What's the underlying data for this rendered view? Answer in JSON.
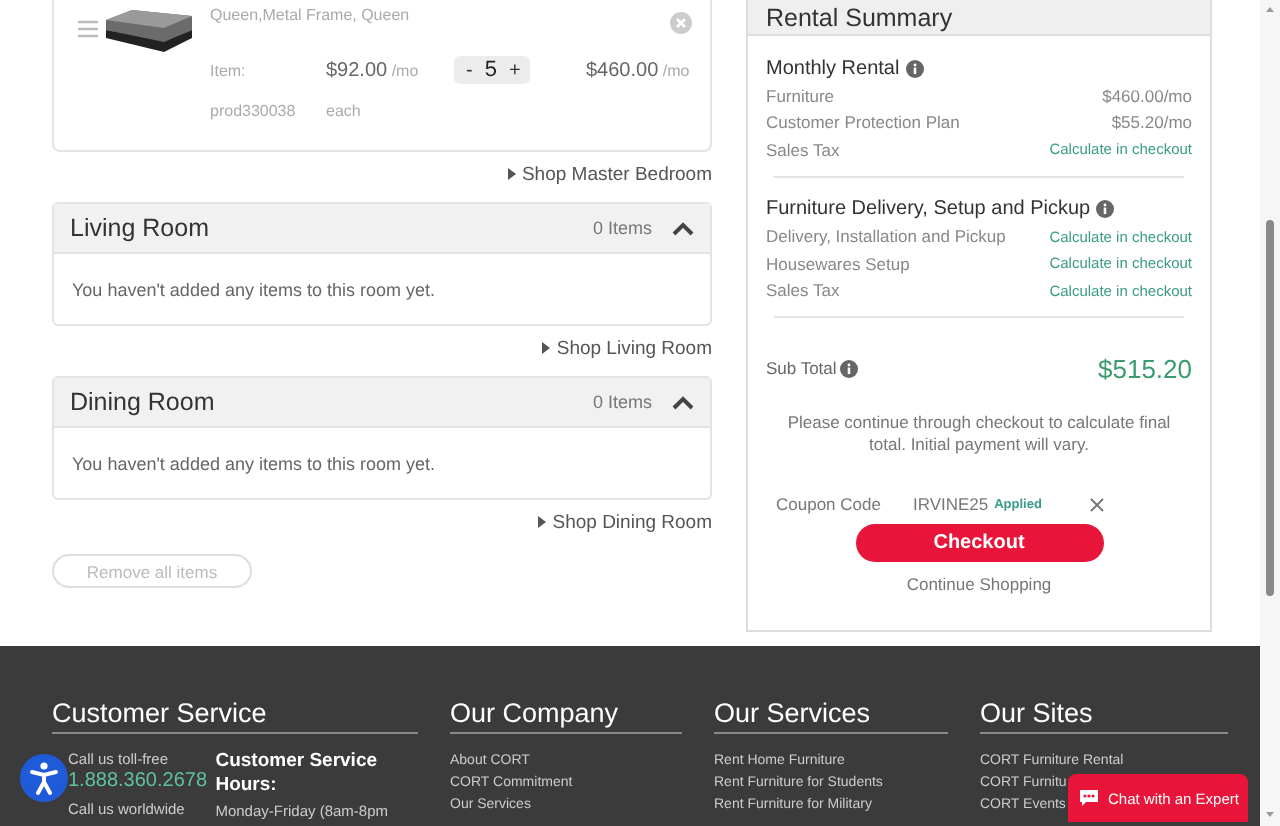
{
  "cart_item": {
    "name": "Queen,Metal Frame, Queen",
    "item_label": "Item:",
    "sku": "prod330038",
    "unit_price": "$92.00",
    "unit_suffix": "/mo",
    "unit_note": "each",
    "quantity": "5",
    "minus": "-",
    "plus": "+",
    "total": "$460.00",
    "total_suffix": "/mo"
  },
  "shop_master_link": "Shop Master Bedroom",
  "rooms": [
    {
      "name": "Living Room",
      "count": "0 Items",
      "expanded": true,
      "empty_message": "You haven't added any items to this room yet.",
      "shop_link": "Shop Living Room"
    },
    {
      "name": "Dining Room",
      "count": "0 Items",
      "expanded": true,
      "empty_message": "You haven't added any items to this room yet.",
      "shop_link": "Shop Dining Room"
    }
  ],
  "remove_all_button": "Remove all items",
  "summary": {
    "title": "Rental Summary",
    "sections": [
      {
        "heading": "Monthly Rental",
        "rows": [
          {
            "label": "Furniture",
            "value": "$460.00/mo",
            "kind": "amount"
          },
          {
            "label": "Customer Protection Plan",
            "value": "$55.20/mo",
            "kind": "amount"
          },
          {
            "label": "Sales Tax",
            "value": "Calculate in checkout",
            "kind": "pending"
          }
        ]
      },
      {
        "heading": "Furniture Delivery, Setup and Pickup",
        "rows": [
          {
            "label": "Delivery, Installation and Pickup",
            "value": "Calculate in checkout",
            "kind": "pending"
          },
          {
            "label": "Housewares Setup",
            "value": "Calculate in checkout",
            "kind": "pending"
          },
          {
            "label": "Sales Tax",
            "value": "Calculate in checkout",
            "kind": "pending"
          }
        ]
      }
    ],
    "subtotal_label": "Sub Total",
    "subtotal_value": "$515.20",
    "note": "Please continue through checkout to calculate final total. Initial payment will vary.",
    "coupon_label": "Coupon Code",
    "coupon_code": "IRVINE25",
    "coupon_status": "Applied",
    "checkout_button": "Checkout",
    "continue_link": "Continue Shopping"
  },
  "footer": {
    "customer_service": {
      "heading": "Customer Service",
      "tollfree_label": "Call us toll-free",
      "phone": "1.888.360.2678",
      "worldwide_label": "Call us worldwide",
      "hours_heading": "Customer Service Hours:",
      "hours": "Monday-Friday (8am-8pm"
    },
    "columns": [
      {
        "heading": "Our Company",
        "links": [
          "About CORT",
          "CORT Commitment",
          "Our Services"
        ]
      },
      {
        "heading": "Our Services",
        "links": [
          "Rent Home Furniture",
          "Rent Furniture for Students",
          "Rent Furniture for Military"
        ]
      },
      {
        "heading": "Our Sites",
        "links": [
          "CORT Furniture Rental",
          "CORT Furnitu",
          "CORT Events"
        ]
      }
    ]
  },
  "chat_button": "Chat with an Expert"
}
